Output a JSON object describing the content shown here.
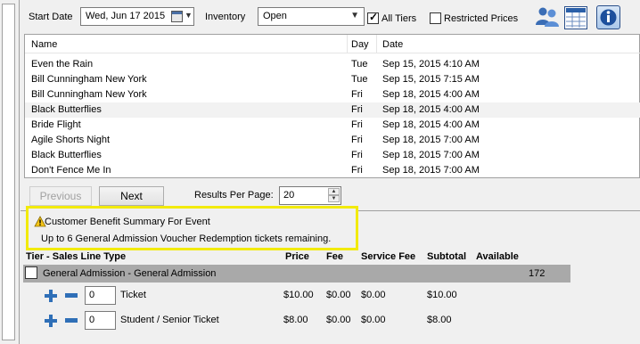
{
  "toolbar": {
    "start_date_label": "Start Date",
    "start_date_value": "Wed, Jun  17 2015",
    "inventory_label": "Inventory",
    "inventory_value": "Open",
    "all_tiers_label": "All Tiers",
    "all_tiers_checked": true,
    "restricted_prices_label": "Restricted Prices",
    "restricted_prices_checked": false,
    "icons": [
      "people-icon",
      "grid-icon",
      "info-icon"
    ]
  },
  "events": {
    "columns": [
      "Name",
      "Day",
      "Date"
    ],
    "rows": [
      {
        "name": "Even the Rain",
        "day": "Tue",
        "date": "Sep 15, 2015 4:10 AM"
      },
      {
        "name": "Bill Cunningham New York",
        "day": "Tue",
        "date": "Sep 15, 2015 7:15 AM"
      },
      {
        "name": "Bill Cunningham New York",
        "day": "Fri",
        "date": "Sep 18, 2015 4:00 AM"
      },
      {
        "name": "Black Butterflies",
        "day": "Fri",
        "date": "Sep 18, 2015 4:00 AM",
        "selected": true
      },
      {
        "name": "Bride Flight",
        "day": "Fri",
        "date": "Sep 18, 2015 4:00 AM"
      },
      {
        "name": "Agile Shorts Night",
        "day": "Fri",
        "date": "Sep 18, 2015 7:00 AM"
      },
      {
        "name": "Black Butterflies",
        "day": "Fri",
        "date": "Sep 18, 2015 7:00 AM"
      },
      {
        "name": "Don't Fence Me In",
        "day": "Fri",
        "date": "Sep 18, 2015 7:00 AM"
      }
    ]
  },
  "paging": {
    "previous_label": "Previous",
    "next_label": "Next",
    "results_per_page_label": "Results Per Page:",
    "results_per_page_value": "20"
  },
  "summary": {
    "title": "Customer Benefit Summary For Event",
    "message": "Up to 6 General Admission Voucher Redemption tickets remaining.",
    "highlight_color": "#f2ea0c"
  },
  "tiers": {
    "columns": {
      "type": "Tier - Sales Line Type",
      "price": "Price",
      "fee": "Fee",
      "service_fee": "Service Fee",
      "subtotal": "Subtotal",
      "available": "Available"
    },
    "tier": {
      "name": "General Admission - General Admission",
      "available": "172"
    },
    "lines": [
      {
        "qty": "0",
        "type": "Ticket",
        "price": "$10.00",
        "fee": "$0.00",
        "service_fee": "$0.00",
        "subtotal": "$10.00"
      },
      {
        "qty": "0",
        "type": "Student / Senior Ticket",
        "price": "$8.00",
        "fee": "$0.00",
        "service_fee": "$0.00",
        "subtotal": "$8.00"
      }
    ]
  }
}
